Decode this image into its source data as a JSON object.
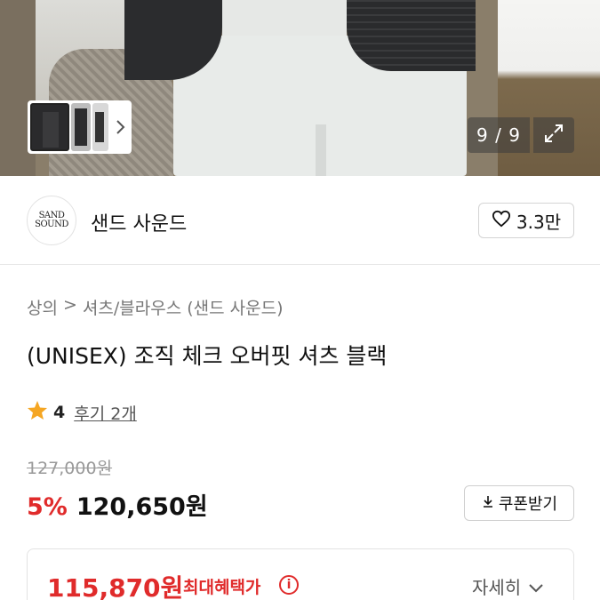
{
  "gallery": {
    "counter": "9 / 9",
    "thumbnails": [
      "thumbnail-1",
      "thumbnail-2",
      "thumbnail-3"
    ],
    "next_icon": "chevron-right-icon",
    "expand_icon": "expand-icon"
  },
  "brand": {
    "logo_line1": "SAND",
    "logo_line2": "SOUND",
    "name": "샌드 사운드",
    "likes": "3.3만",
    "like_icon": "heart-icon"
  },
  "product": {
    "breadcrumb": [
      "상의",
      ">",
      "셔츠/블라우스 (샌드 사운드)"
    ],
    "title": "(UNISEX) 조직 체크 오버핏 셔츠 블랙",
    "rating": "4",
    "reviews": "후기 2개",
    "original_price": "127,000원",
    "discount": "5%",
    "price": "120,650원",
    "coupon_label": "쿠폰받기",
    "benefit_price": "115,870원",
    "benefit_label": "최대혜택가",
    "detail_label": "자세히"
  },
  "colors": {
    "accent_red": "#e02b2b",
    "star": "#f5a623"
  }
}
